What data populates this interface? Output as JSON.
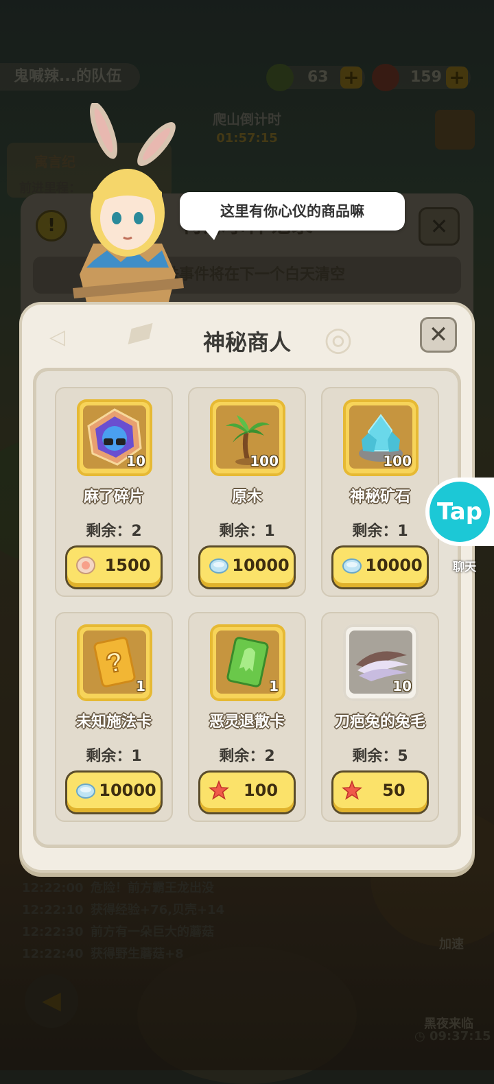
{
  "background": {
    "team_name": "鬼喊辣...的队伍",
    "resource1": "63",
    "resource2": "159",
    "climb_label": "爬山倒计时",
    "climb_time": "01:57:15",
    "left_panel_title": "寓言纪",
    "left_panel_progress": "前进里程：",
    "events_title": "特殊事件记录",
    "events_sub": "特殊事件将在下一个白天清空",
    "log": [
      {
        "time": "12:22:00",
        "text": "危险！前方霸王龙出没"
      },
      {
        "time": "12:22:10",
        "text": "获得经验+76,贝壳+14"
      },
      {
        "time": "12:22:30",
        "text": "前方有一朵巨大的蘑菇"
      },
      {
        "time": "12:22:40",
        "text": "获得野生蘑菇+8"
      }
    ],
    "speedup_label": "加速",
    "night_label": "黑夜来临",
    "night_timer": "09:37:15"
  },
  "speech": "这里有你心仪的商品嘛",
  "dialog": {
    "title": "神秘商人",
    "close_symbol": "✕"
  },
  "items": [
    {
      "name": "麻了碎片",
      "qty": "10",
      "remain": "剩余：2",
      "price": "1500",
      "currency": "pearl-icon",
      "icon": "crystal-shard-icon"
    },
    {
      "name": "原木",
      "qty": "100",
      "remain": "剩余：1",
      "price": "10000",
      "currency": "shell-icon",
      "icon": "palm-tree-icon"
    },
    {
      "name": "神秘矿石",
      "qty": "100",
      "remain": "剩余：1",
      "price": "10000",
      "currency": "shell-icon",
      "icon": "mystery-ore-icon"
    },
    {
      "name": "未知施法卡",
      "qty": "1",
      "remain": "剩余：1",
      "price": "10000",
      "currency": "shell-icon",
      "icon": "unknown-card-icon"
    },
    {
      "name": "恶灵退散卡",
      "qty": "1",
      "remain": "剩余：2",
      "price": "100",
      "currency": "starfish-icon",
      "icon": "ghost-repel-card-icon"
    },
    {
      "name": "刀疤兔的兔毛",
      "qty": "10",
      "remain": "剩余：5",
      "price": "50",
      "currency": "starfish-icon",
      "icon": "rabbit-fur-icon"
    }
  ],
  "tap": {
    "label": "Tap",
    "chat": "聊天"
  },
  "colors": {
    "accent": "#fbe26a",
    "panel": "#f2ede3",
    "tap": "#1cc8d6"
  }
}
